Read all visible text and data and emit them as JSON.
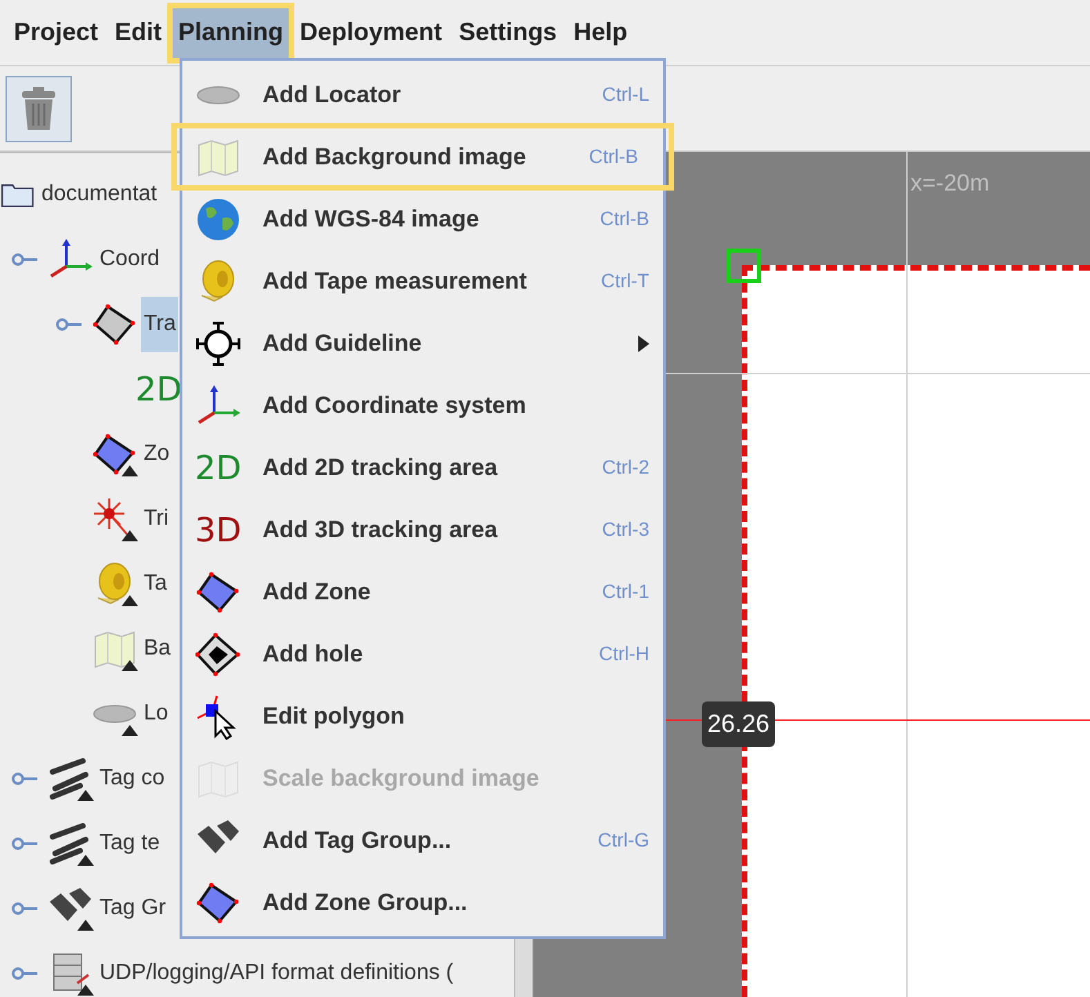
{
  "menubar": [
    {
      "label": "Project",
      "selected": false,
      "highlighted": false
    },
    {
      "label": "Edit",
      "selected": false,
      "highlighted": false
    },
    {
      "label": "Planning",
      "selected": true,
      "highlighted": true
    },
    {
      "label": "Deployment",
      "selected": false,
      "highlighted": false
    },
    {
      "label": "Settings",
      "selected": false,
      "highlighted": false
    },
    {
      "label": "Help",
      "selected": false,
      "highlighted": false
    }
  ],
  "toolbar": {
    "delete_button": {
      "kind": "trash"
    }
  },
  "tree": [
    {
      "label": "documentat",
      "kind": "folder",
      "expandable": false,
      "selected": false,
      "marked": false,
      "children": [
        {
          "label": "Coord",
          "kind": "axes",
          "expandable": true,
          "selected": false,
          "marked": false,
          "children": [
            {
              "label": "Tra",
              "kind": "polygon",
              "expandable": true,
              "selected": true,
              "marked": false,
              "children": [
                {
                  "kind": "text",
                  "icon_text": "2D",
                  "color": "#1e8a2e",
                  "expandable": false,
                  "marked": false
                }
              ]
            },
            {
              "label": "Zo",
              "kind": "zone",
              "expandable": false,
              "selected": false,
              "marked": true
            },
            {
              "label": "Tri",
              "kind": "trigger",
              "expandable": false,
              "selected": false,
              "marked": true
            },
            {
              "label": "Ta",
              "kind": "tape",
              "expandable": false,
              "selected": false,
              "marked": true
            },
            {
              "label": "Ba",
              "kind": "map",
              "expandable": false,
              "selected": false,
              "marked": true
            },
            {
              "label": "Lo",
              "kind": "locator",
              "expandable": false,
              "selected": false,
              "marked": true
            }
          ]
        },
        {
          "label": "Tag co",
          "kind": "wrench",
          "expandable": true,
          "selected": false,
          "marked": true
        },
        {
          "label": "Tag te",
          "kind": "wrench",
          "expandable": true,
          "selected": false,
          "marked": true
        },
        {
          "label": "Tag Gr",
          "kind": "tags",
          "expandable": true,
          "selected": false,
          "marked": true
        },
        {
          "label": "UDP/logging/API format definitions (",
          "kind": "server",
          "expandable": true,
          "selected": false,
          "marked": true
        }
      ]
    }
  ],
  "menu": [
    {
      "label": "Add Locator",
      "shortcut": "Ctrl-L",
      "kind": "locator",
      "disabled": false,
      "highlighted": false,
      "submenu": false
    },
    {
      "label": "Add Background image",
      "shortcut": "Ctrl-B",
      "kind": "map",
      "disabled": false,
      "highlighted": true,
      "submenu": false
    },
    {
      "label": "Add WGS-84 image",
      "shortcut": "Ctrl-B",
      "kind": "globe",
      "disabled": false,
      "highlighted": false,
      "submenu": false
    },
    {
      "label": "Add Tape measurement",
      "shortcut": "Ctrl-T",
      "kind": "tape",
      "disabled": false,
      "highlighted": false,
      "submenu": false
    },
    {
      "label": "Add Guideline",
      "kind": "guideline",
      "disabled": false,
      "highlighted": false,
      "submenu": true
    },
    {
      "label": "Add Coordinate system",
      "kind": "axes",
      "disabled": false,
      "highlighted": false,
      "submenu": false
    },
    {
      "label": "Add 2D tracking area",
      "shortcut": "Ctrl-2",
      "kind": "text",
      "icon_text": "2D",
      "color": "#1e8a2e",
      "disabled": false,
      "highlighted": false,
      "submenu": false
    },
    {
      "label": "Add 3D tracking area",
      "shortcut": "Ctrl-3",
      "kind": "text",
      "icon_text": "3D",
      "color": "#a01010",
      "disabled": false,
      "highlighted": false,
      "submenu": false
    },
    {
      "label": "Add Zone",
      "shortcut": "Ctrl-1",
      "kind": "zone",
      "disabled": false,
      "highlighted": false,
      "submenu": false
    },
    {
      "label": "Add hole",
      "shortcut": "Ctrl-H",
      "kind": "hole",
      "disabled": false,
      "highlighted": false,
      "submenu": false
    },
    {
      "label": "Edit polygon",
      "kind": "edit",
      "disabled": false,
      "highlighted": false,
      "submenu": false
    },
    {
      "label": "Scale background image",
      "kind": "map",
      "disabled": true,
      "highlighted": false,
      "submenu": false
    },
    {
      "label": "Add Tag Group...",
      "shortcut": "Ctrl-G",
      "kind": "tags",
      "disabled": false,
      "highlighted": false,
      "submenu": false
    },
    {
      "label": "Add Zone Group...",
      "kind": "zone",
      "disabled": false,
      "highlighted": false,
      "submenu": false
    }
  ],
  "canvas": {
    "axis_label": "x=-20m",
    "coordinate_readout": "26.26"
  }
}
